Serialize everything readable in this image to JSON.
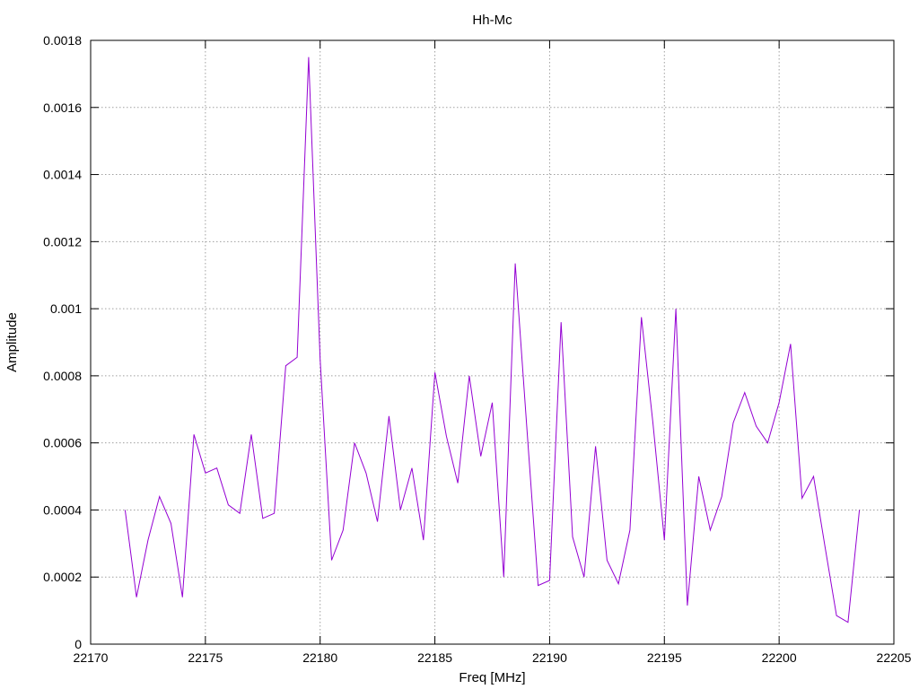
{
  "chart_data": {
    "type": "line",
    "title": "Hh-Mc",
    "xlabel": "Freq [MHz]",
    "ylabel": "Amplitude",
    "xlim": [
      22170,
      22205
    ],
    "ylim": [
      0,
      0.0018
    ],
    "x_ticks": [
      22170,
      22175,
      22180,
      22185,
      22190,
      22195,
      22200,
      22205
    ],
    "x_tick_labels": [
      "22170",
      "22175",
      "22180",
      "22185",
      "22190",
      "22195",
      "22200",
      "22205"
    ],
    "y_ticks": [
      0,
      0.0002,
      0.0004,
      0.0006,
      0.0008,
      0.001,
      0.0012,
      0.0014,
      0.0016,
      0.0018
    ],
    "y_tick_labels": [
      "0",
      "0.0002",
      "0.0004",
      "0.0006",
      "0.0008",
      "0.001",
      "0.0012",
      "0.0014",
      "0.0016",
      "0.0018"
    ],
    "grid": true,
    "line_color": "#9400d3",
    "series": [
      {
        "x": [
          22171.5,
          22172.0,
          22172.5,
          22173.0,
          22173.5,
          22174.0,
          22174.5,
          22175.0,
          22175.5,
          22176.0,
          22176.5,
          22177.0,
          22177.5,
          22178.0,
          22178.5,
          22179.0,
          22179.5,
          22180.0,
          22180.5,
          22181.0,
          22181.5,
          22182.0,
          22182.5,
          22183.0,
          22183.5,
          22184.0,
          22184.5,
          22185.0,
          22185.5,
          22186.0,
          22186.5,
          22187.0,
          22187.5,
          22188.0,
          22188.5,
          22189.0,
          22189.5,
          22190.0,
          22190.5,
          22191.0,
          22191.5,
          22192.0,
          22192.5,
          22193.0,
          22193.5,
          22194.0,
          22194.5,
          22195.0,
          22195.5,
          22196.0,
          22196.5,
          22197.0,
          22197.5,
          22198.0,
          22198.5,
          22199.0,
          22199.5,
          22200.0,
          22200.5,
          22201.0,
          22201.5,
          22202.0,
          22202.5,
          22203.0,
          22203.5
        ],
        "values": [
          0.0004,
          0.00014,
          0.00031,
          0.00044,
          0.00036,
          0.00014,
          0.000625,
          0.00051,
          0.000525,
          0.000415,
          0.00039,
          0.000625,
          0.000375,
          0.00039,
          0.00083,
          0.000855,
          0.00175,
          0.00085,
          0.00025,
          0.00034,
          0.0006,
          0.00051,
          0.000365,
          0.00068,
          0.0004,
          0.000525,
          0.00031,
          0.00081,
          0.00062,
          0.00048,
          0.0008,
          0.00056,
          0.00072,
          0.0002,
          0.001135,
          0.00065,
          0.000175,
          0.00019,
          0.00096,
          0.00032,
          0.0002,
          0.00059,
          0.00025,
          0.00018,
          0.00034,
          0.000975,
          0.00066,
          0.00031,
          0.001,
          0.000115,
          0.0005,
          0.00034,
          0.00044,
          0.00066,
          0.00075,
          0.00065,
          0.0006,
          0.00072,
          0.000895,
          0.000435,
          0.0005,
          0.00029,
          8.5e-05,
          6.5e-05,
          0.0004
        ]
      }
    ]
  }
}
